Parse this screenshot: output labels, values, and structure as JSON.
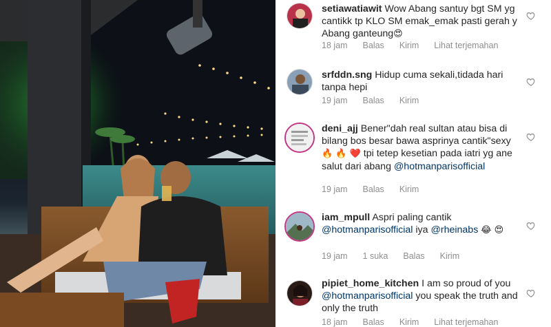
{
  "photo": {
    "alt_subject": ""
  },
  "comments": [
    {
      "username": "setiawatiawit",
      "text_parts": [
        {
          "t": "text",
          "v": "Wow Abang santuy bgt SM yg cantikk tp KLO SM emak_emak pasti gerah y Abang ganteung"
        },
        {
          "t": "emoji",
          "v": "😍"
        }
      ],
      "meta": {
        "time": "18 jam",
        "reply": "Balas",
        "send": "Kirim",
        "translate": "Lihat terjemahan"
      }
    },
    {
      "username": "srfddn.sng",
      "text_parts": [
        {
          "t": "text",
          "v": "Hidup cuma sekali,tidada hari tanpa hepi"
        }
      ],
      "meta": {
        "time": "19 jam",
        "reply": "Balas",
        "send": "Kirim"
      }
    },
    {
      "username": "deni_ajj",
      "text_parts": [
        {
          "t": "text",
          "v": "Bener\"dah real sultan atau bisa di bilang bos besar bawa asprinya cantik\"sexy "
        },
        {
          "t": "emoji",
          "v": "🔥 🔥 ❤️"
        },
        {
          "t": "text",
          "v": " tpi tetep kesetian pada iatri yg ane salut dari abang "
        },
        {
          "t": "mention",
          "v": "@hotmanparisofficial"
        }
      ],
      "meta": {
        "time": "19 jam",
        "reply": "Balas",
        "send": "Kirim"
      }
    },
    {
      "username": "iam_mpull",
      "text_parts": [
        {
          "t": "text",
          "v": "Aspri paling cantik "
        },
        {
          "t": "mention",
          "v": "@hotmanparisofficial"
        },
        {
          "t": "text",
          "v": "  iya "
        },
        {
          "t": "mention",
          "v": "@rheinabs"
        },
        {
          "t": "text",
          "v": " "
        },
        {
          "t": "emoji",
          "v": "😂 😍"
        }
      ],
      "meta": {
        "time": "19 jam",
        "likes": "1 suka",
        "reply": "Balas",
        "send": "Kirim"
      }
    },
    {
      "username": "pipiet_home_kitchen",
      "text_parts": [
        {
          "t": "text",
          "v": "I am so proud of you "
        },
        {
          "t": "mention",
          "v": "@hotmanparisofficial"
        },
        {
          "t": "text",
          "v": "  you speak the truth and only the truth"
        }
      ],
      "meta": {
        "time": "18 jam",
        "reply": "Balas",
        "send": "Kirim",
        "translate": "Lihat terjemahan"
      }
    }
  ],
  "colors": {
    "text": "#262626",
    "muted": "#8e8e8e",
    "mention": "#00376b",
    "story_ring": "#c13584"
  },
  "icons": {
    "like": "heart-outline-icon"
  }
}
